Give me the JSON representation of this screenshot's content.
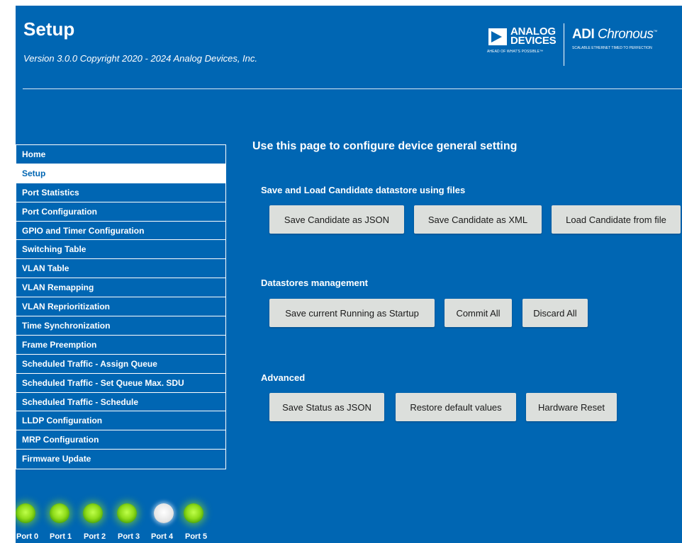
{
  "header": {
    "title": "Setup",
    "version": "Version 3.0.0 Copyright 2020 - 2024 Analog Devices, Inc.",
    "adi_logo_text": "ANALOG\nDEVICES",
    "adi_logo_tagline": "AHEAD OF WHAT'S POSSIBLE™",
    "chronous_prefix": "ADI",
    "chronous_name": "Chronous",
    "chronous_tm": "™",
    "chronous_tagline": "SCALABLE ETHERNET TIMED TO PERFECTION"
  },
  "nav": {
    "items": [
      {
        "label": "Home"
      },
      {
        "label": "Setup",
        "active": true
      },
      {
        "label": "Port Statistics"
      },
      {
        "label": "Port Configuration"
      },
      {
        "label": "GPIO and Timer Configuration"
      },
      {
        "label": "Switching Table"
      },
      {
        "label": "VLAN Table"
      },
      {
        "label": "VLAN Remapping"
      },
      {
        "label": "VLAN Reprioritization"
      },
      {
        "label": "Time Synchronization"
      },
      {
        "label": "Frame Preemption"
      },
      {
        "label": "Scheduled Traffic - Assign Queue"
      },
      {
        "label": "Scheduled Traffic - Set Queue Max. SDU"
      },
      {
        "label": "Scheduled Traffic - Schedule"
      },
      {
        "label": "LLDP Configuration"
      },
      {
        "label": "MRP Configuration"
      },
      {
        "label": "Firmware Update"
      }
    ]
  },
  "content": {
    "heading": "Use this page to configure device general setting",
    "sections": [
      {
        "title": "Save and Load Candidate datastore using files",
        "buttons": [
          "Save Candidate as JSON",
          "Save Candidate as XML",
          "Load Candidate from file"
        ]
      },
      {
        "title": "Datastores management",
        "buttons": [
          "Save current Running as Startup",
          "Commit All",
          "Discard All"
        ]
      },
      {
        "title": "Advanced",
        "buttons": [
          "Save Status as JSON",
          "Restore default values",
          "Hardware Reset"
        ]
      }
    ]
  },
  "ports": [
    {
      "label": "Port 0",
      "status": "on"
    },
    {
      "label": "Port 1",
      "status": "on"
    },
    {
      "label": "Port 2",
      "status": "on"
    },
    {
      "label": "Port 3",
      "status": "on"
    },
    {
      "label": "Port 4",
      "status": "off"
    },
    {
      "label": "Port 5",
      "status": "on"
    }
  ],
  "colors": {
    "background": "#0066b3",
    "button": "#dcdfdc",
    "led_on": "#8fdc1a",
    "led_off": "#e6e6e6"
  }
}
